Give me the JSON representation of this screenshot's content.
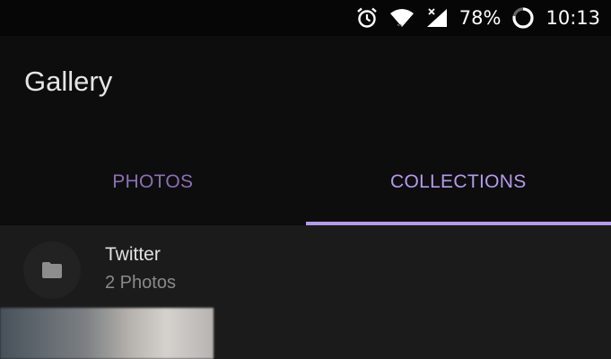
{
  "status_bar": {
    "battery_percent": "78%",
    "time": "10:13",
    "icons": [
      "alarm-icon",
      "wifi-icon",
      "signal-icon",
      "battery-icon"
    ]
  },
  "app_bar": {
    "title": "Gallery"
  },
  "tabs": [
    {
      "label": "PHOTOS",
      "active": false
    },
    {
      "label": "COLLECTIONS",
      "active": true
    }
  ],
  "collections": [
    {
      "name": "Twitter",
      "count": "2 Photos",
      "icon": "folder-icon"
    }
  ],
  "colors": {
    "accent": "#b59aeb",
    "inactive_tab": "#8b6fb2",
    "background": "#0d0d0e"
  }
}
